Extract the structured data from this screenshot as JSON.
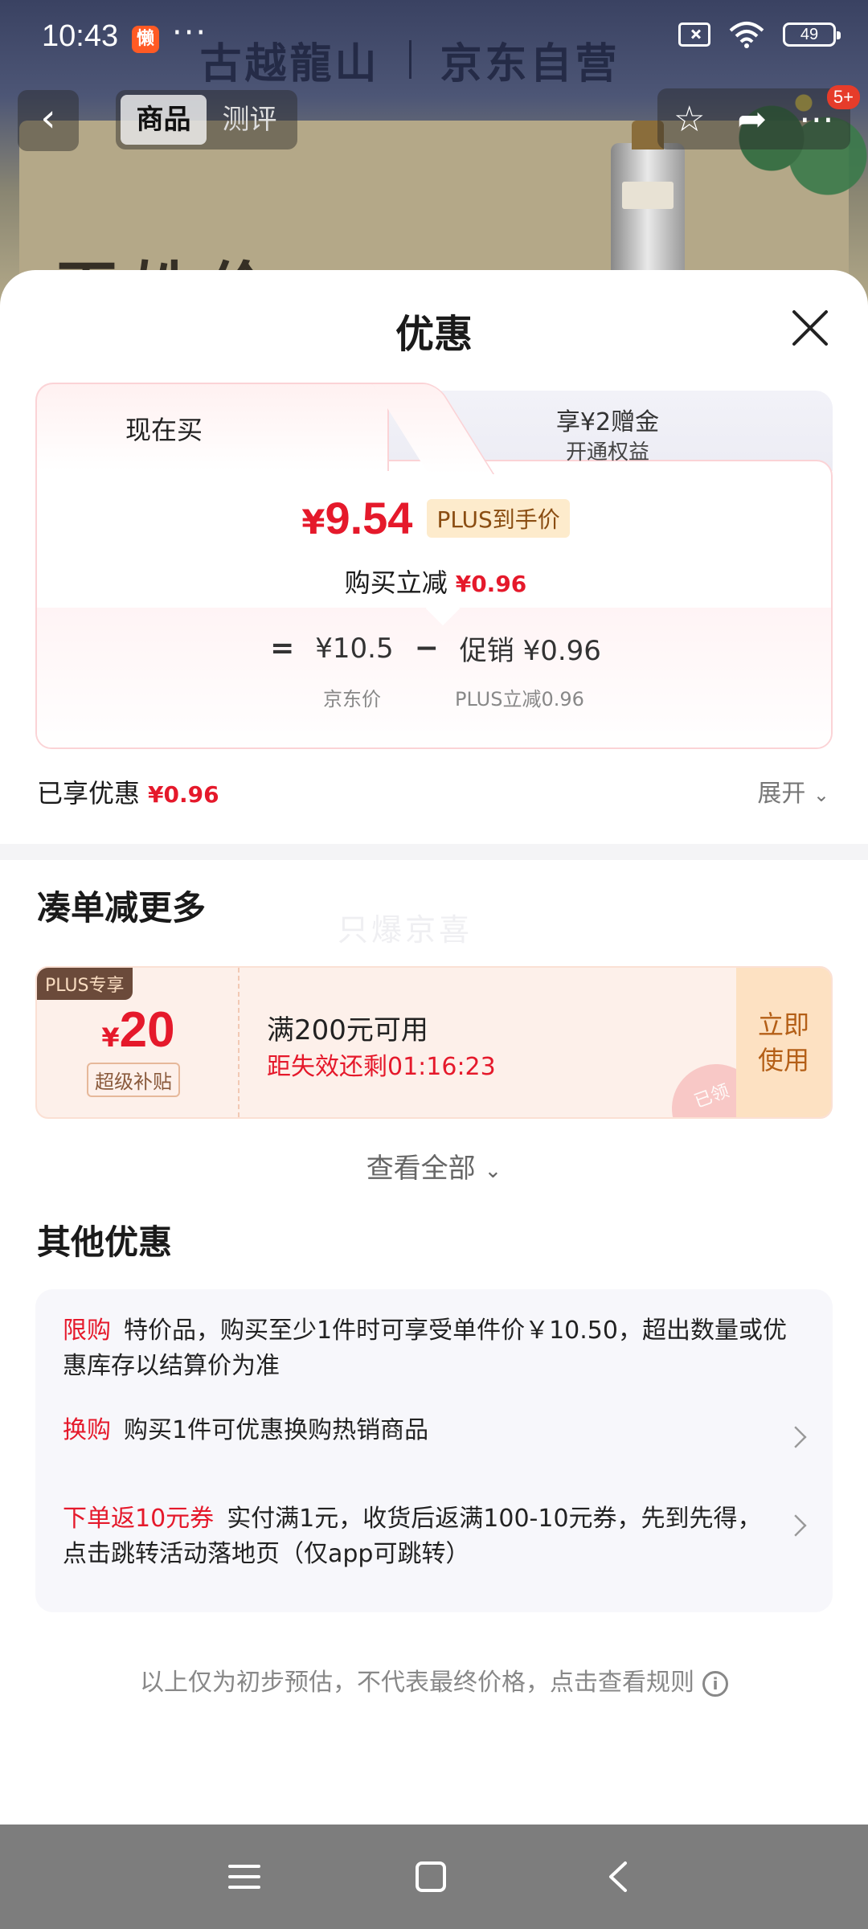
{
  "status_bar": {
    "time": "10:43",
    "app_icon_text": "懒",
    "more": "···",
    "battery": "49"
  },
  "background_page": {
    "banner_brand": "古越龍山",
    "banner_store": "京东自营",
    "headline": "百姓价",
    "tabs": [
      {
        "label": "商品"
      },
      {
        "label": "测评"
      }
    ],
    "badge": "5+"
  },
  "sheet": {
    "title": "优惠",
    "tab_now": "现在买",
    "tab_other_title": "享¥2赠金",
    "tab_other_sub": "开通权益",
    "price_yen": "¥",
    "price": "9.54",
    "price_badge": "PLUS到手价",
    "reduce_label": "购买立减",
    "reduce_value": "¥0.96",
    "formula": {
      "equals": "=",
      "jd_price": "¥10.5",
      "minus": "−",
      "promo_label": "促销",
      "promo_value": "¥0.96",
      "jd_price_label": "京东价",
      "promo_sub_label": "PLUS立减0.96"
    },
    "enjoyed_label": "已享优惠",
    "enjoyed_value": "¥0.96",
    "expand_label": "展开",
    "more_discount_title": "凑单减更多",
    "watermark": "只爆京喜",
    "coupon": {
      "tag": "PLUS专享",
      "yen": "¥",
      "amount": "20",
      "subtitle": "超级补贴",
      "condition": "满200元可用",
      "timer": "距失效还剩01:16:23",
      "button_line1": "立即",
      "button_line2": "使用",
      "stamp": "已领"
    },
    "view_all": "查看全部",
    "other_title": "其他优惠",
    "offers": [
      {
        "label": "限购",
        "text": "特价品，购买至少1件时可享受单件价￥10.50，超出数量或优惠库存以结算价为准"
      },
      {
        "label": "换购",
        "text": "购买1件可优惠换购热销商品"
      },
      {
        "label": "下单返10元券",
        "text": "实付满1元，收货后返满100-10元券，先到先得，点击跳转活动落地页（仅app可跳转）"
      }
    ],
    "footnote": "以上仅为初步预估，不代表最终价格，点击查看规则",
    "info_glyph": "i"
  },
  "colors": {
    "accent_red": "#e5192b",
    "plus_gold": "#8a4d12"
  }
}
